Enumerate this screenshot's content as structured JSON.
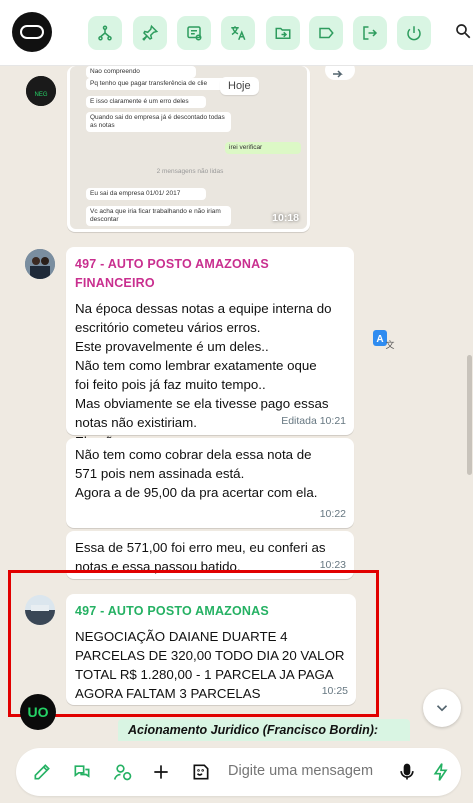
{
  "toolbar": {
    "buttons": [
      "flow-icon",
      "pin-icon",
      "note-icon",
      "translate-icon",
      "folder-icon",
      "label-icon",
      "exit-icon",
      "power-icon"
    ],
    "accent": "#2e9c5e",
    "button_bg": "#d9f5e3"
  },
  "preview": {
    "hoje": "Hoje",
    "lines": [
      "Nao compreendo",
      "Pq tenho que pagar transferência de clie",
      "E isso claramente é um erro deles",
      "Quando sai do empresa já é descontado todas as notas",
      "irei verificar",
      "2 mensagens não lidas",
      "Eu sai da empresa 01/01/ 2017",
      "Vc acha que iria ficar trabalhando e não iriam descontar"
    ],
    "time": "10:18"
  },
  "messages": [
    {
      "sender": "497 - AUTO POSTO AMAZONAS FINANCEIRO",
      "lines": [
        "Na época dessas notas a equipe interna do",
        "escritório cometeu vários erros.",
        "Este provavelmente é um deles..",
        "Não tem como lembrar exatamente oque",
        "foi feito pois já faz muito tempo..",
        "Mas obviamente se ela tivesse pago essas",
        "notas não existiriam.",
        "Ela não quer pagar."
      ],
      "time": "Editada 10:21"
    },
    {
      "lines": [
        "Não tem como cobrar dela essa nota de",
        "571 pois nem assinada está.",
        "Agora a de 95,00 da pra acertar com ela."
      ],
      "time": "10:22"
    },
    {
      "lines": [
        "Essa de 571,00 foi erro meu, eu conferi as",
        "notas e essa passou batido."
      ],
      "time": "10:23"
    },
    {
      "sender": "497 - AUTO POSTO AMAZONAS",
      "lines": [
        "NEGOCIAÇÃO DAIANE DUARTE 4",
        "PARCELAS DE 320,00 TODO DIA 20 VALOR",
        "TOTAL R$ 1.280,00 - 1 PARCELA JA PAGA",
        "AGORA FALTAM 3 PARCELAS"
      ],
      "time": "10:25"
    }
  ],
  "pinned_note": "Acionamento Juridico (Francisco Bordin):",
  "composer": {
    "placeholder": "Digite uma mensagem"
  },
  "colors": {
    "financeiro_sender": "#c92f8f",
    "amazonas_sender": "#25b163",
    "highlight_box": "#e10000"
  }
}
